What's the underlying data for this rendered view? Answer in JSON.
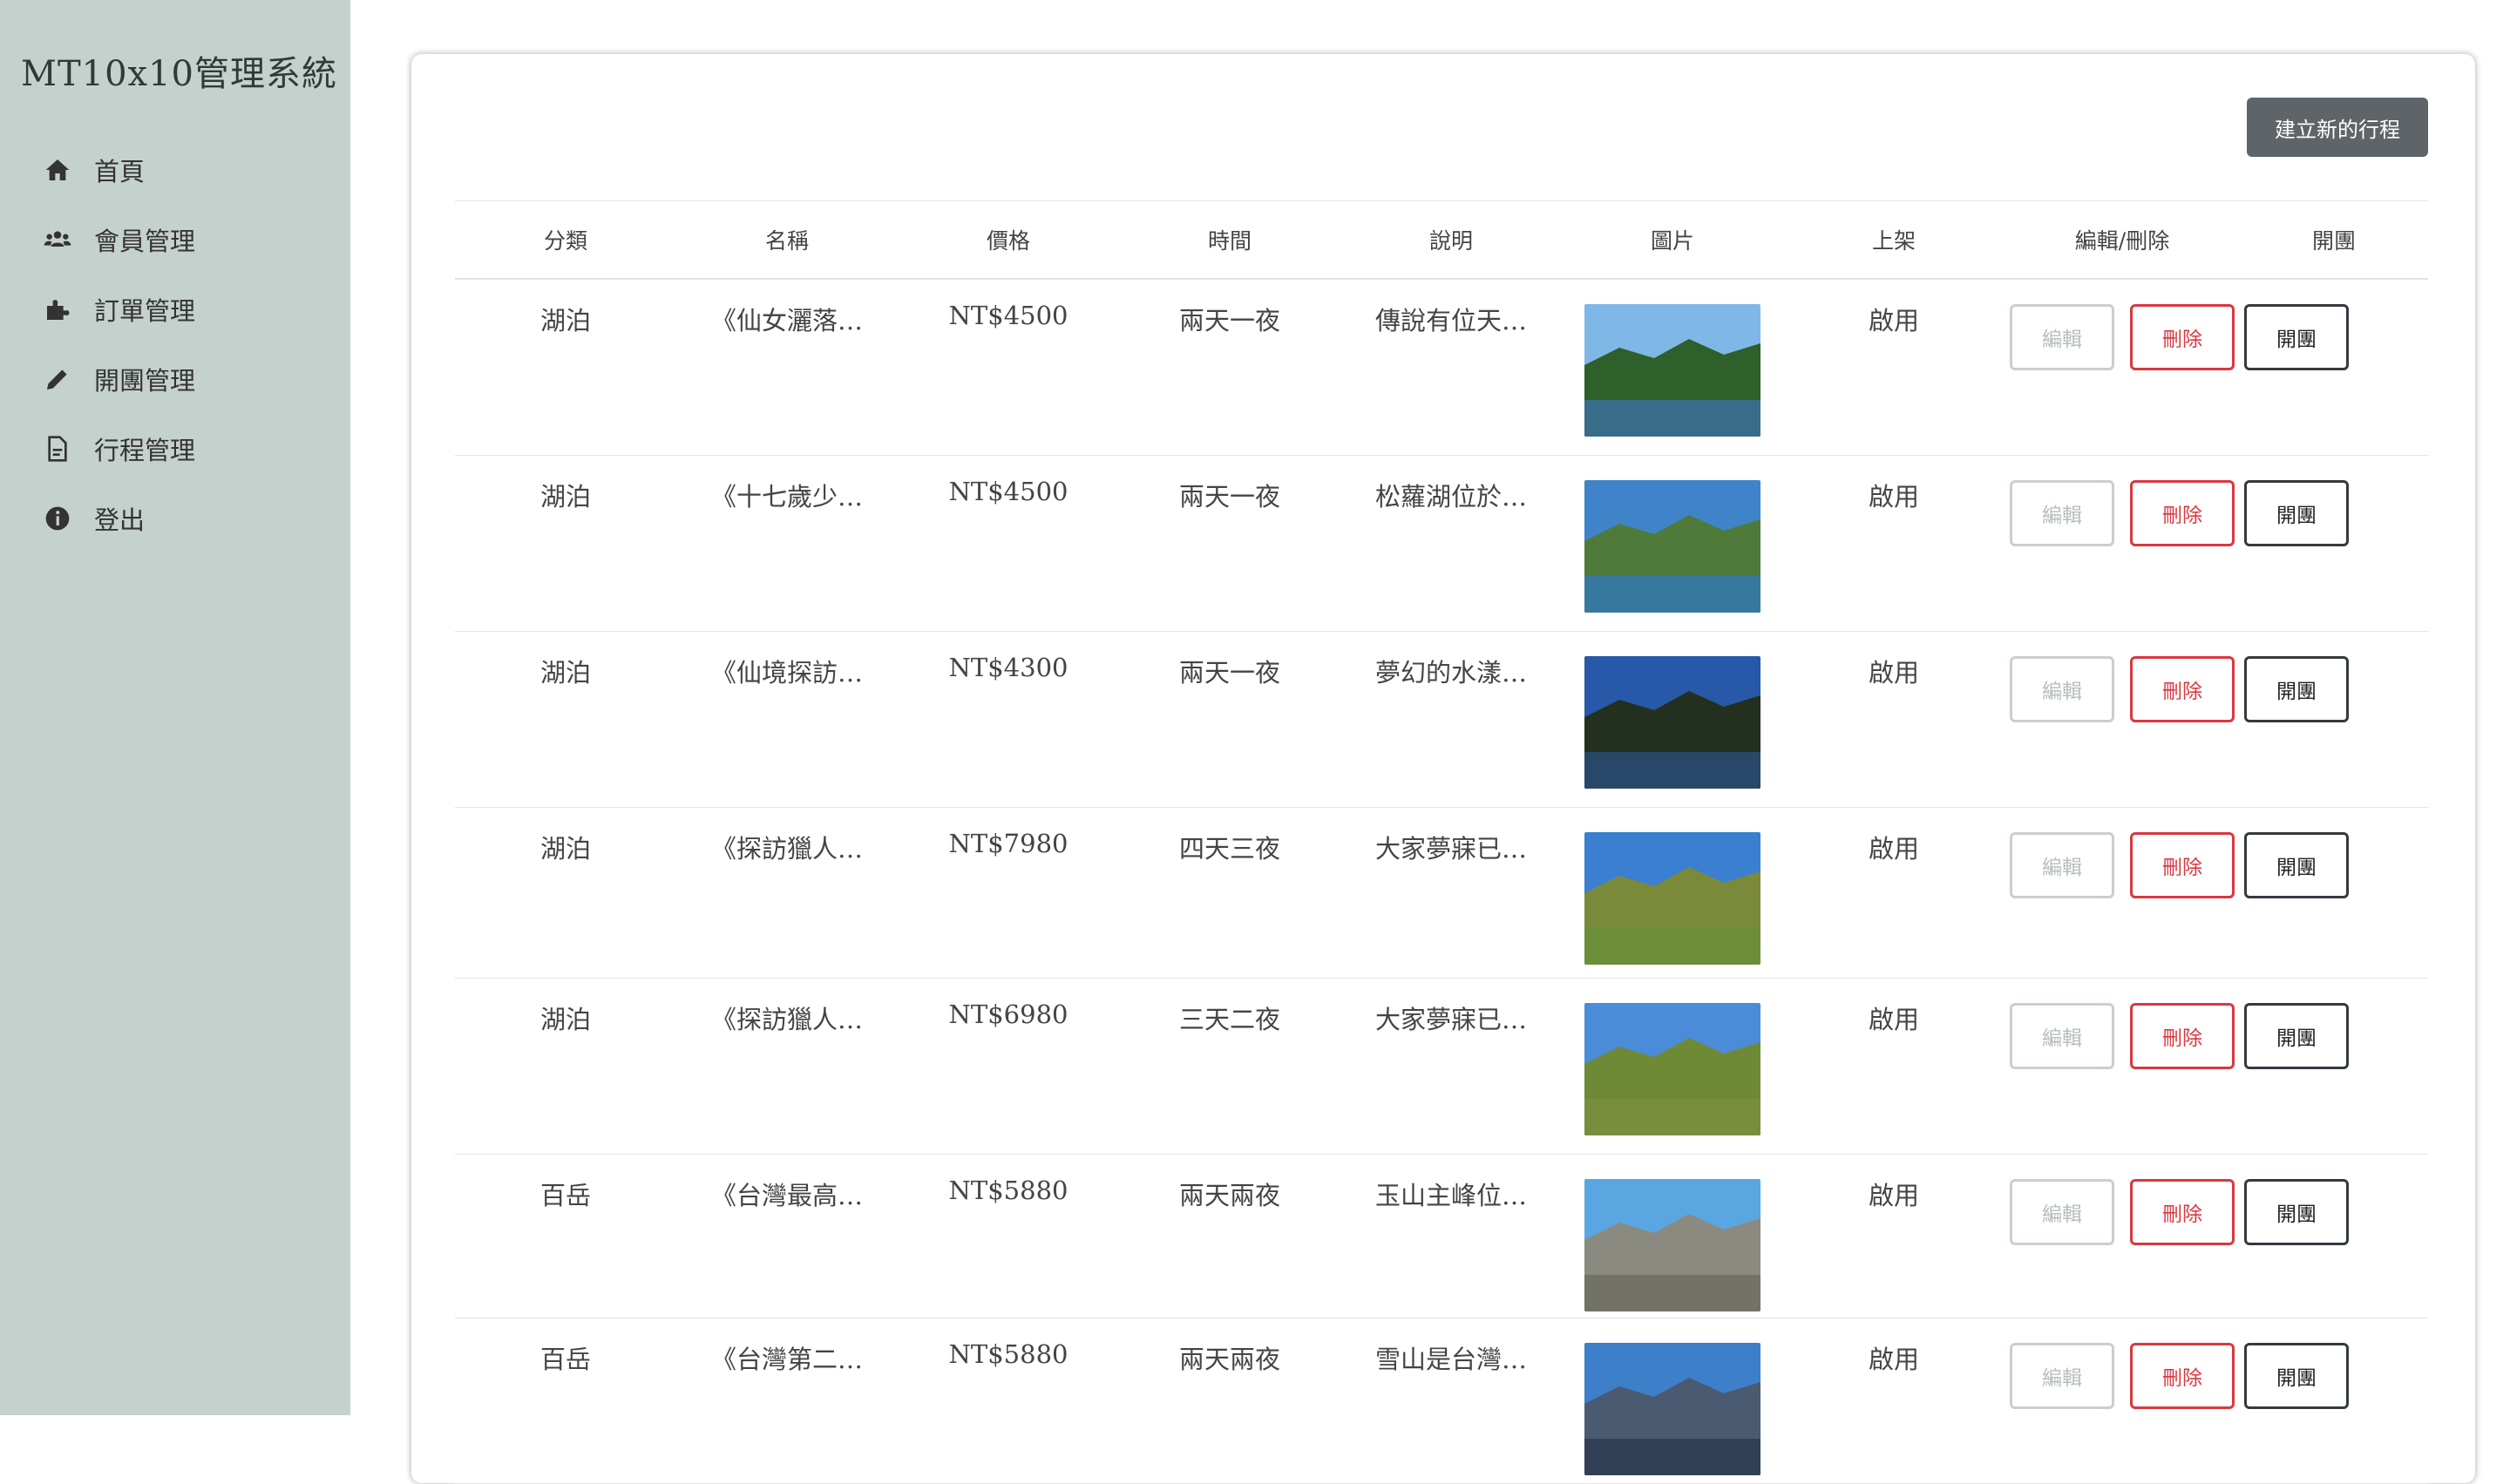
{
  "sidebar": {
    "title": "MT10x10管理系統",
    "items": [
      {
        "label": "首頁",
        "icon": "home-icon"
      },
      {
        "label": "會員管理",
        "icon": "users-icon"
      },
      {
        "label": "訂單管理",
        "icon": "puzzle-icon"
      },
      {
        "label": "開團管理",
        "icon": "pencil-icon"
      },
      {
        "label": "行程管理",
        "icon": "document-icon"
      },
      {
        "label": "登出",
        "icon": "info-icon"
      }
    ]
  },
  "toolbar": {
    "create_label": "建立新的行程"
  },
  "table": {
    "headers": [
      "分類",
      "名稱",
      "價格",
      "時間",
      "說明",
      "圖片",
      "上架",
      "編輯/刪除",
      "開團"
    ],
    "edit_label": "編輯",
    "delete_label": "刪除",
    "open_label": "開團",
    "rows": [
      {
        "category": "湖泊",
        "name": "《仙女灑落…",
        "price": "NT$4500",
        "duration": "兩天一夜",
        "desc": "傳說有位天…",
        "status": "啟用"
      },
      {
        "category": "湖泊",
        "name": "《十七歲少…",
        "price": "NT$4500",
        "duration": "兩天一夜",
        "desc": "松蘿湖位於…",
        "status": "啟用"
      },
      {
        "category": "湖泊",
        "name": "《仙境探訪…",
        "price": "NT$4300",
        "duration": "兩天一夜",
        "desc": "夢幻的水漾…",
        "status": "啟用"
      },
      {
        "category": "湖泊",
        "name": "《探訪獵人…",
        "price": "NT$7980",
        "duration": "四天三夜",
        "desc": "大家夢寐已…",
        "status": "啟用"
      },
      {
        "category": "湖泊",
        "name": "《探訪獵人…",
        "price": "NT$6980",
        "duration": "三天二夜",
        "desc": "大家夢寐已…",
        "status": "啟用"
      },
      {
        "category": "百岳",
        "name": "《台灣最高…",
        "price": "NT$5880",
        "duration": "兩天兩夜",
        "desc": "玉山主峰位…",
        "status": "啟用"
      },
      {
        "category": "百岳",
        "name": "《台灣第二…",
        "price": "NT$5880",
        "duration": "兩天兩夜",
        "desc": "雪山是台灣…",
        "status": "啟用"
      }
    ]
  },
  "colors": {
    "sidebar_bg": "#c5d1cc",
    "status_green": "#3cb371",
    "delete_red": "#d9383f",
    "create_btn": "#5e6468"
  }
}
